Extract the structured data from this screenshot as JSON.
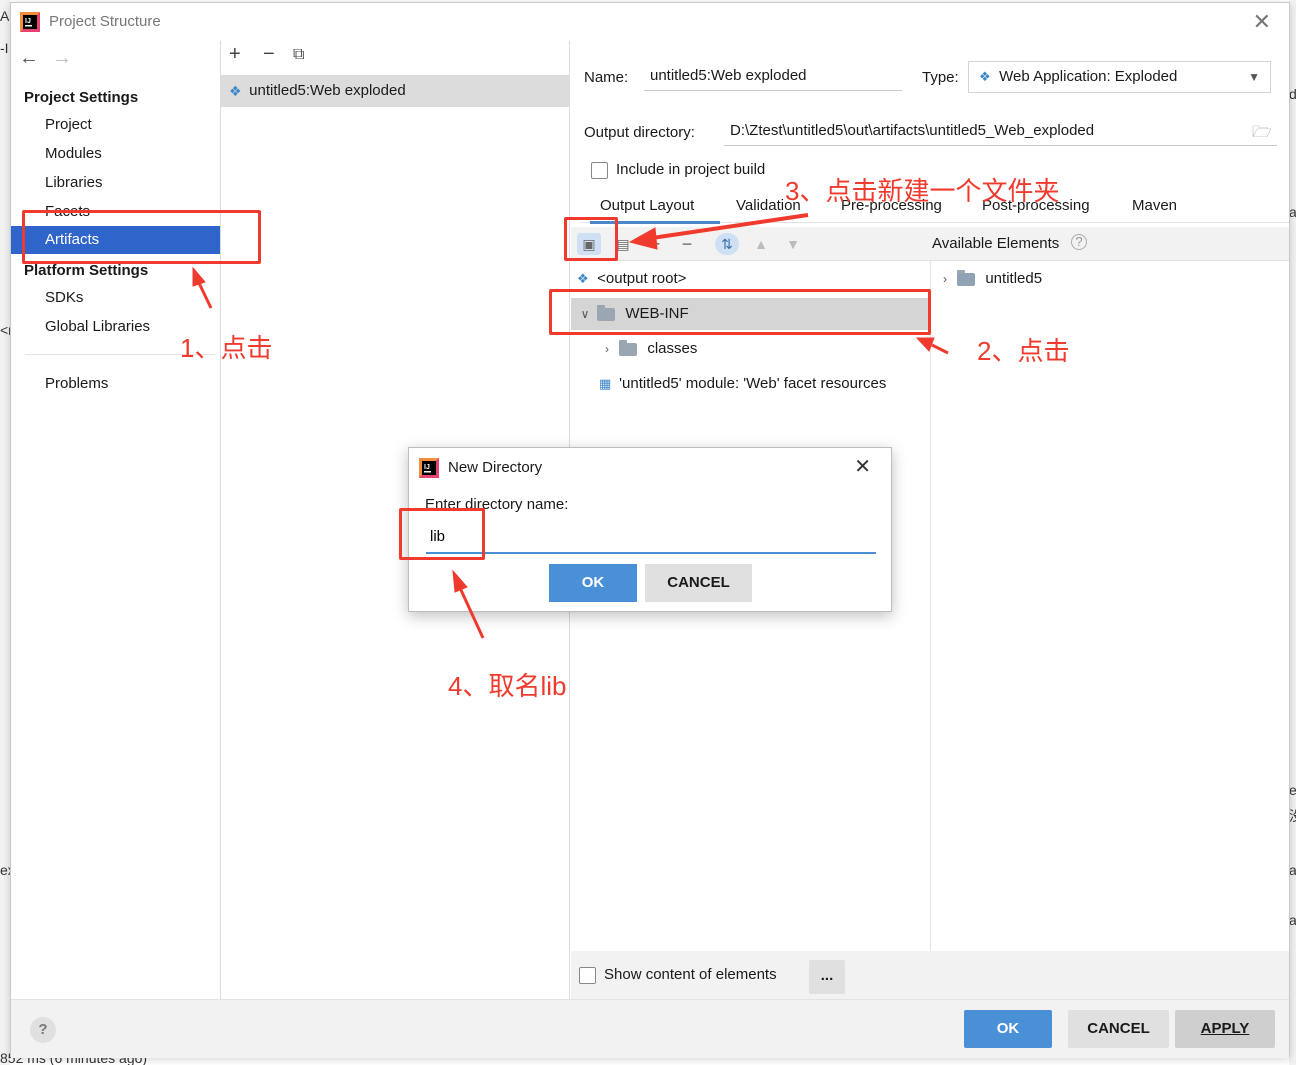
{
  "window": {
    "title": "Project Structure"
  },
  "background": {
    "frag_top_left": "A",
    "frag_top_left2": "-I",
    "frag_mid_left": "<n",
    "frag_lower_left": "ex",
    "frag_right_1": "d",
    "frag_right_2": "a",
    "frag_right_3": "e",
    "frag_right_4": "没",
    "frag_right_5": "a",
    "frag_right_6": "a",
    "status_line": "852 ms (6 minutes ago)"
  },
  "left_nav": {
    "project_settings_header": "Project Settings",
    "items_project": [
      "Project",
      "Modules",
      "Libraries",
      "Facets",
      "Artifacts"
    ],
    "platform_settings_header": "Platform Settings",
    "items_platform": [
      "SDKs",
      "Global Libraries"
    ],
    "problems": "Problems",
    "selected": "Artifacts"
  },
  "artifact_list": {
    "items": [
      "untitled5:Web exploded"
    ]
  },
  "details": {
    "name_label": "Name:",
    "name_value": "untitled5:Web exploded",
    "type_label": "Type:",
    "type_value": "Web Application: Exploded",
    "output_dir_label": "Output directory:",
    "output_dir_value": "D:\\Ztest\\untitled5\\out\\artifacts\\untitled5_Web_exploded",
    "include_build_label": "Include in project build",
    "tabs": [
      "Output Layout",
      "Validation",
      "Pre-processing",
      "Post-processing",
      "Maven"
    ],
    "active_tab": "Output Layout",
    "available_elements_label": "Available Elements",
    "tree_left": {
      "output_root": "<output root>",
      "web_inf": "WEB-INF",
      "classes": "classes",
      "facet_resources": "'untitled5' module: 'Web' facet resources"
    },
    "tree_right": {
      "untitled5": "untitled5"
    },
    "show_content_label": "Show content of elements",
    "dots_label": "..."
  },
  "footer": {
    "help": "?",
    "ok": "OK",
    "cancel": "CANCEL",
    "apply": "APPLY"
  },
  "modal": {
    "title": "New Directory",
    "prompt": "Enter directory name:",
    "input_value": "lib",
    "ok": "OK",
    "cancel": "CANCEL"
  },
  "annotations": {
    "step1": "1、点击",
    "step2": "2、点击",
    "step3": "3、点击新建一个文件夹",
    "step4": "4、取名lib",
    "color": "#f03a2e"
  },
  "colors": {
    "selection": "#2f65ca",
    "primary_button": "#4a90d6",
    "annotation_red": "#f03a2e"
  }
}
